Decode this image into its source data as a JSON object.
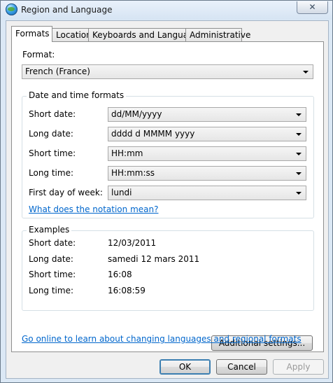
{
  "window": {
    "title": "Region and Language",
    "close_glyph": "✕"
  },
  "tabs": [
    {
      "label": "Formats"
    },
    {
      "label": "Location"
    },
    {
      "label": "Keyboards and Languages"
    },
    {
      "label": "Administrative"
    }
  ],
  "format": {
    "label": "Format:",
    "value": "French (France)"
  },
  "datetime": {
    "title": "Date and time formats",
    "short_date": {
      "label": "Short date:",
      "value": "dd/MM/yyyy"
    },
    "long_date": {
      "label": "Long date:",
      "value": "dddd d MMMM yyyy"
    },
    "short_time": {
      "label": "Short time:",
      "value": "HH:mm"
    },
    "long_time": {
      "label": "Long time:",
      "value": "HH:mm:ss"
    },
    "first_day": {
      "label": "First day of week:",
      "value": "lundi"
    },
    "notation_link": "What does the notation mean?"
  },
  "examples": {
    "title": "Examples",
    "short_date": {
      "label": "Short date:",
      "value": "12/03/2011"
    },
    "long_date": {
      "label": "Long date:",
      "value": "samedi 12 mars 2011"
    },
    "short_time": {
      "label": "Short time:",
      "value": "16:08"
    },
    "long_time": {
      "label": "Long time:",
      "value": "16:08:59"
    }
  },
  "additional_settings": "Additional settings...",
  "online_link": "Go online to learn about changing languages and regional formats",
  "buttons": {
    "ok": "OK",
    "cancel": "Cancel",
    "apply": "Apply"
  }
}
